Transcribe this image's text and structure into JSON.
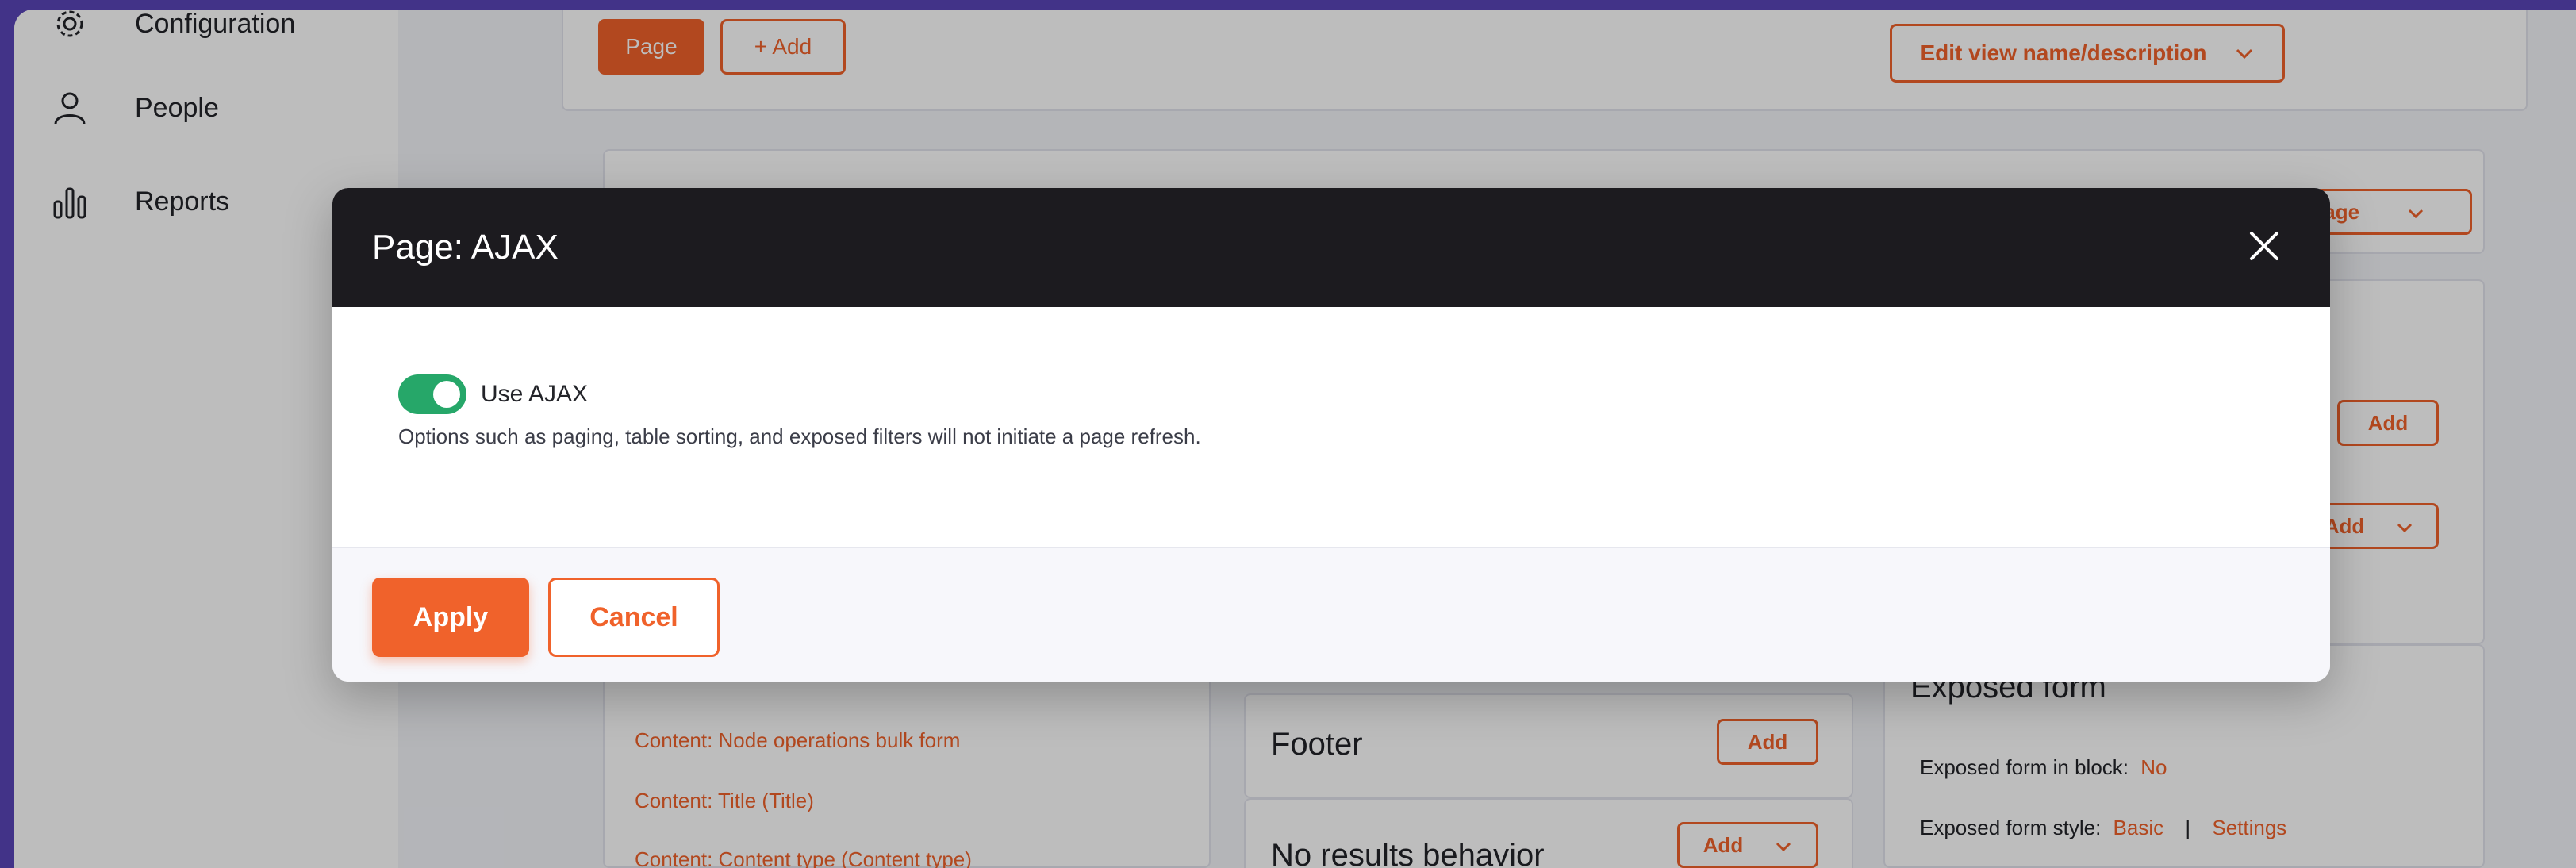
{
  "sidebar": {
    "items": [
      {
        "label": "Configuration",
        "icon": "gear-icon"
      },
      {
        "label": "People",
        "icon": "person-icon"
      },
      {
        "label": "Reports",
        "icon": "bar-chart-icon"
      }
    ]
  },
  "views_ui": {
    "display_tab_label": "Page",
    "add_display_label": "+ Add",
    "edit_view_name_label": "Edit view name/description",
    "display_page_button": "Page",
    "add_labels": [
      "Add",
      "Add",
      "Add",
      "Add"
    ],
    "fields": [
      "Content: Node operations bulk form",
      "Content: Title (Title)",
      "Content: Content type (Content type)"
    ],
    "footer_title": "Footer",
    "no_results_title": "No results behavior",
    "exposed_form": {
      "title": "Exposed form",
      "in_block_label": "Exposed form in block:",
      "in_block_value": "No",
      "style_label": "Exposed form style:",
      "style_value": "Basic",
      "settings_link": "Settings"
    }
  },
  "dialog": {
    "title": "Page: AJAX",
    "toggle": {
      "label": "Use AJAX",
      "checked": true
    },
    "description": "Options such as paging, table sorting, and exposed filters will not initiate a page refresh.",
    "apply_label": "Apply",
    "cancel_label": "Cancel"
  },
  "colors": {
    "accent": "#f0622b",
    "dialog_header": "#1c1b1f",
    "toggle_on": "#26a769",
    "frame": "#5a45b8"
  }
}
